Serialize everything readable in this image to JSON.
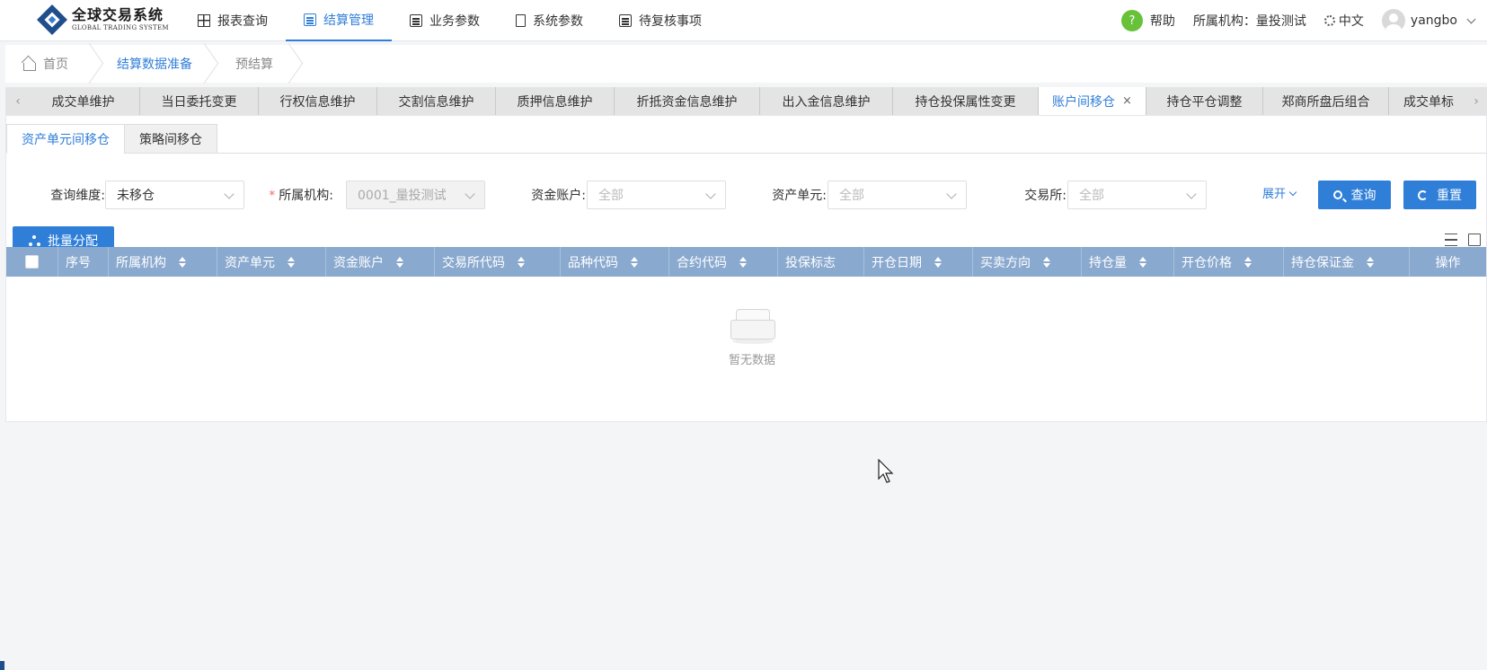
{
  "brand": {
    "name_cn": "全球交易系统",
    "name_en": "GLOBAL TRADING SYSTEM"
  },
  "nav": [
    {
      "label": "报表查询",
      "icon": "grid-icon",
      "active": false
    },
    {
      "label": "结算管理",
      "icon": "settlement-icon",
      "active": true
    },
    {
      "label": "业务参数",
      "icon": "document-icon",
      "active": false
    },
    {
      "label": "系统参数",
      "icon": "book-icon",
      "active": false
    },
    {
      "label": "待复核事项",
      "icon": "checklist-icon",
      "active": false
    }
  ],
  "header_right": {
    "help_icon": "?",
    "help": "帮助",
    "org_label": "所属机构：",
    "org_value": "量投测试",
    "language": "中文",
    "username": "yangbo"
  },
  "breadcrumb": [
    {
      "label": "首页"
    },
    {
      "label": "结算数据准备"
    },
    {
      "label": "预结算"
    }
  ],
  "tabs": {
    "prev": "‹",
    "next": "›",
    "close": "×",
    "items": [
      {
        "label": "成交单维护"
      },
      {
        "label": "当日委托变更"
      },
      {
        "label": "行权信息维护"
      },
      {
        "label": "交割信息维护"
      },
      {
        "label": "质押信息维护"
      },
      {
        "label": "折抵资金信息维护"
      },
      {
        "label": "出入金信息维护"
      },
      {
        "label": "持仓投保属性变更"
      },
      {
        "label": "账户间移仓",
        "active": true
      },
      {
        "label": "持仓平仓调整"
      },
      {
        "label": "郑商所盘后组合"
      },
      {
        "label": "成交单标"
      }
    ]
  },
  "subtabs": [
    {
      "label": "资产单元间移仓",
      "active": true
    },
    {
      "label": "策略间移仓",
      "active": false
    }
  ],
  "filters": {
    "dimension": {
      "label": "查询维度:",
      "value": "未移仓"
    },
    "org": {
      "required_mark": "*",
      "label": "所属机构:",
      "value": "0001_量投测试"
    },
    "fund_account": {
      "label": "资金账户:",
      "placeholder": "全部"
    },
    "asset_unit": {
      "label": "资产单元:",
      "placeholder": "全部"
    },
    "exchange": {
      "label": "交易所:",
      "placeholder": "全部"
    },
    "expand": "展开",
    "query": "查询",
    "reset": "重置"
  },
  "toolbar": {
    "batch_assign": "批量分配"
  },
  "table": {
    "columns": [
      "序号",
      "所属机构",
      "资产单元",
      "资金账户",
      "交易所代码",
      "品种代码",
      "合约代码",
      "投保标志",
      "开仓日期",
      "买卖方向",
      "持仓量",
      "开仓价格",
      "持仓保证金",
      "操作"
    ],
    "rows": [],
    "empty_text": "暂无数据"
  },
  "colors": {
    "accent": "#2f7ed8",
    "table_header": "#8aa9cf",
    "help": "#67c23a"
  }
}
